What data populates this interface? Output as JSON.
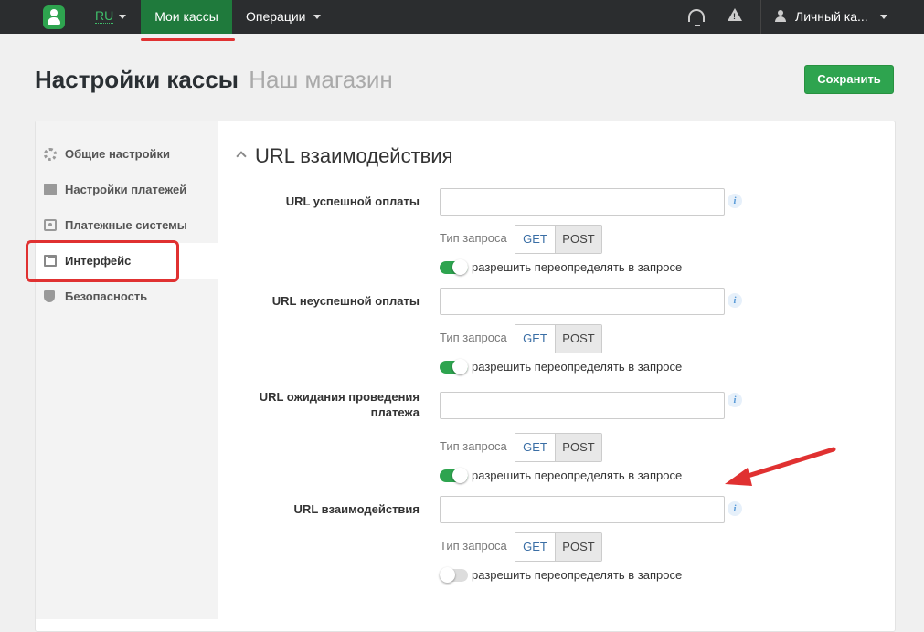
{
  "topbar": {
    "lang": "RU",
    "nav_active": "Мои кассы",
    "nav_operations": "Операции",
    "account": "Личный ка..."
  },
  "header": {
    "title": "Настройки кассы",
    "subtitle": "Наш магазин",
    "save_label": "Сохранить"
  },
  "sidebar": {
    "items": [
      {
        "label": "Общие настройки",
        "icon": "gear-icon"
      },
      {
        "label": "Настройки платежей",
        "icon": "card-icon"
      },
      {
        "label": "Платежные системы",
        "icon": "cash-icon"
      },
      {
        "label": "Интерфейс",
        "icon": "window-icon",
        "active": true
      },
      {
        "label": "Безопасность",
        "icon": "shield-icon"
      }
    ]
  },
  "section": {
    "title": "URL взаимодействия",
    "rows": [
      {
        "label": "URL успешной оплаты",
        "value": "",
        "request_type_label": "Тип запроса",
        "get": "GET",
        "post": "POST",
        "selected": "POST",
        "override_label": "разрешить переопределять в запросе",
        "override_on": true
      },
      {
        "label": "URL неуспешной оплаты",
        "value": "",
        "request_type_label": "Тип запроса",
        "get": "GET",
        "post": "POST",
        "selected": "POST",
        "override_label": "разрешить переопределять в запросе",
        "override_on": true
      },
      {
        "label": "URL ожидания проведения платежа",
        "value": "",
        "request_type_label": "Тип запроса",
        "get": "GET",
        "post": "POST",
        "selected": "POST",
        "override_label": "разрешить переопределять в запросе",
        "override_on": true
      },
      {
        "label": "URL взаимодействия",
        "value": "",
        "request_type_label": "Тип запроса",
        "get": "GET",
        "post": "POST",
        "selected": "POST",
        "override_label": "разрешить переопределять в запросе",
        "override_on": false
      }
    ]
  },
  "colors": {
    "accent": "#2ea44f",
    "annotation": "#e03131"
  }
}
